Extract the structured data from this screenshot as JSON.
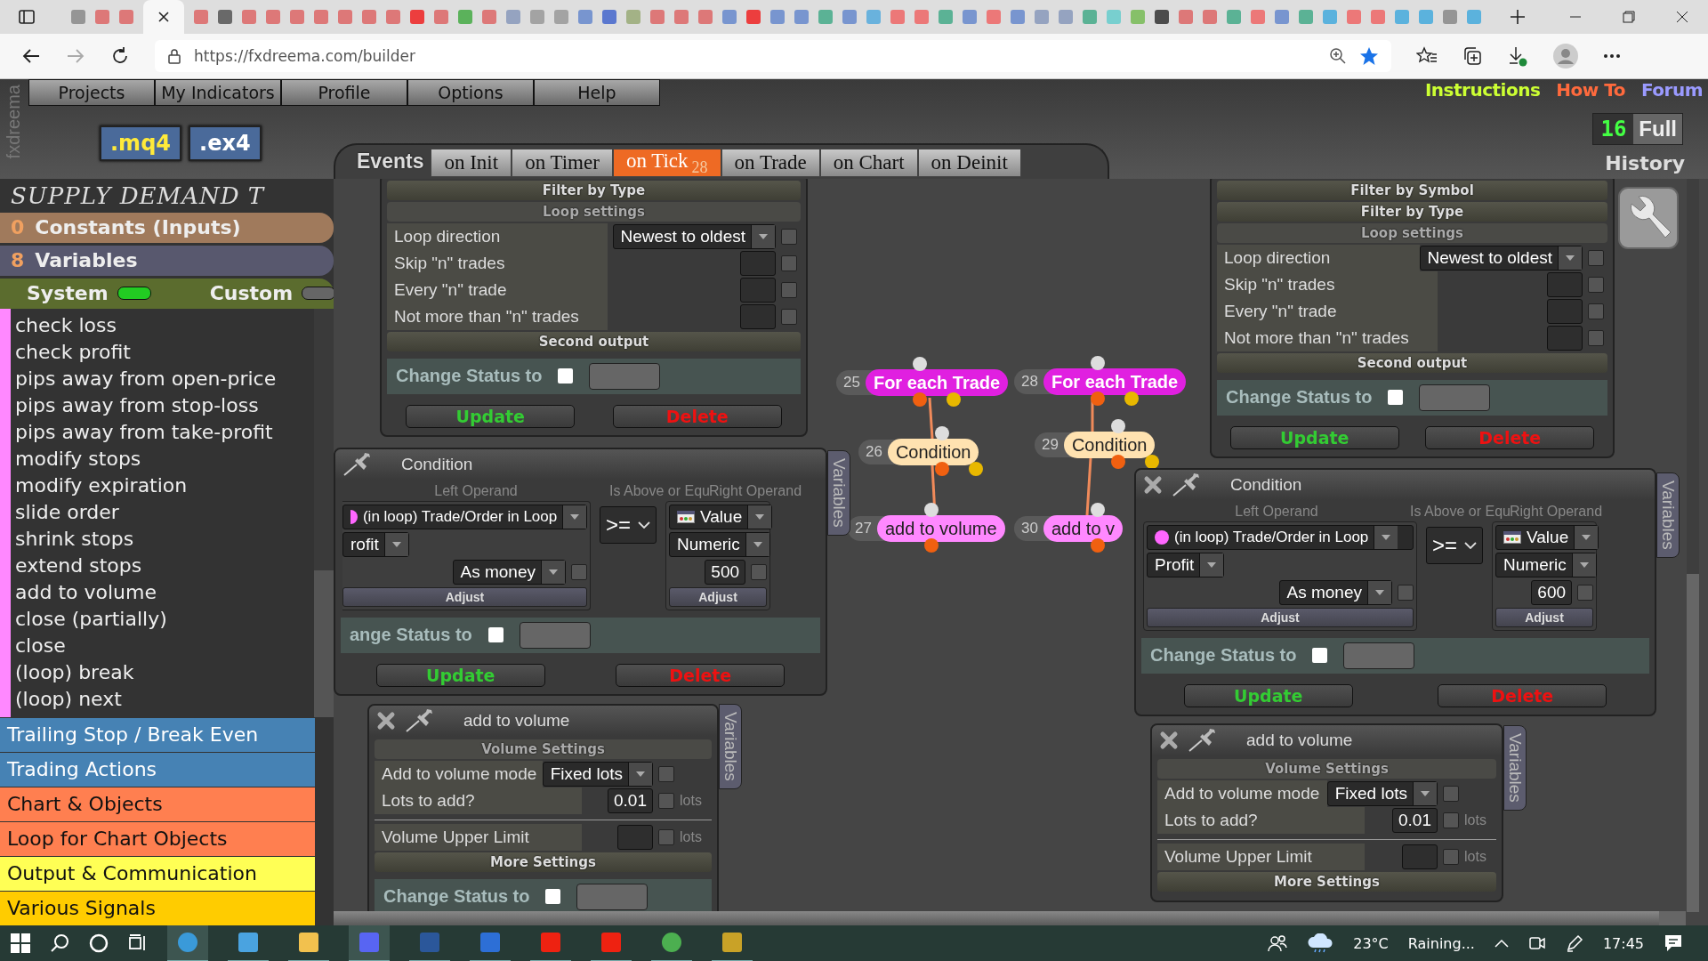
{
  "browser": {
    "url": "https://fxdreema.com/builder"
  },
  "header": {
    "brand": "fxdreema",
    "menu": [
      "Projects",
      "My Indicators",
      "Profile",
      "Options",
      "Help"
    ],
    "links": [
      {
        "label": "Instructions",
        "color": "#ccff33"
      },
      {
        "label": "How To",
        "color": "#ff6a3d"
      },
      {
        "label": "Forum",
        "color": "#9a9aff"
      }
    ],
    "exports": [
      ".mq4",
      ".ex4"
    ],
    "history": {
      "count": "16",
      "mode": "Full",
      "label": "History"
    }
  },
  "events": {
    "label": "Events",
    "tabs": [
      {
        "label": "on Init",
        "selected": false
      },
      {
        "label": "on Timer",
        "selected": false
      },
      {
        "label": "on Tick",
        "badge": "28",
        "selected": true
      },
      {
        "label": "on Trade",
        "selected": false
      },
      {
        "label": "on Chart",
        "selected": false
      },
      {
        "label": "on Deinit",
        "selected": false
      }
    ]
  },
  "sidebar": {
    "project": "SUPPLY DEMAND T",
    "constants": {
      "count": "0",
      "label": "Constants (Inputs)"
    },
    "variables": {
      "count": "8",
      "label": "Variables"
    },
    "toggles": [
      {
        "label": "System",
        "on": true
      },
      {
        "label": "Custom",
        "on": false
      }
    ],
    "blocks": [
      "check loss",
      "check profit",
      "pips away from open-price",
      "pips away from stop-loss",
      "pips away from take-profit",
      "modify stops",
      "modify expiration",
      "slide order",
      "shrink stops",
      "extend stops",
      "add to volume",
      "close (partially)",
      "close",
      "(loop) break",
      "(loop) next"
    ],
    "categories": [
      {
        "label": "Trailing Stop / Break Even",
        "color": "#4682b4"
      },
      {
        "label": "Trading Actions",
        "color": "#4682b4"
      },
      {
        "label": "Chart & Objects",
        "color": "#ff7f50"
      },
      {
        "label": "Loop for Chart Objects",
        "color": "#ff7f50"
      },
      {
        "label": "Output & Communication",
        "color": "#ffff55"
      },
      {
        "label": "Various Signals",
        "color": "#ffcc00"
      }
    ]
  },
  "canvas": {
    "panels": [
      {
        "kind": "loop",
        "filters": [
          "Filter by Type"
        ],
        "header": "Loop settings",
        "rows": [
          {
            "label": "Loop direction",
            "value": "Newest to oldest",
            "checked": false
          },
          {
            "label": "Skip \"n\" trades",
            "checked": false
          },
          {
            "label": "Every \"n\" trade",
            "checked": false
          },
          {
            "label": "Not more than \"n\" trades",
            "checked": false
          }
        ],
        "second": "Second output",
        "status": {
          "label": "Change Status to",
          "checked": false
        },
        "buttons": [
          "Update",
          "Delete"
        ]
      },
      {
        "kind": "loop",
        "filters": [
          "Filter by Symbol",
          "Filter by Type"
        ],
        "header": "Loop settings",
        "rows": [
          {
            "label": "Loop direction",
            "value": "Newest to oldest",
            "checked": false
          },
          {
            "label": "Skip \"n\" trades",
            "checked": false
          },
          {
            "label": "Every \"n\" trade",
            "checked": false
          },
          {
            "label": "Not more than \"n\" trades",
            "checked": false
          }
        ],
        "second": "Second output",
        "status": {
          "label": "Change Status to",
          "checked": false
        },
        "buttons": [
          "Update",
          "Delete"
        ]
      },
      {
        "kind": "condition",
        "closable": false,
        "title": "Condition",
        "labels": [
          "Left Operand",
          "Is Above or Equ",
          "Right Operand"
        ],
        "left": {
          "source": "(in loop) Trade/Order in Loop",
          "field": "rofit",
          "mode": "As money",
          "checked": false,
          "adjust": "Adjust"
        },
        "operator": ">=",
        "right": {
          "type": "Value",
          "format": "Numeric",
          "value": "500",
          "checked": false,
          "adjust": "Adjust"
        },
        "status": {
          "label": "ange Status to",
          "checked": false
        },
        "buttons": [
          "Update",
          "Delete"
        ],
        "tab": "Variables"
      },
      {
        "kind": "condition",
        "closable": true,
        "title": "Condition",
        "labels": [
          "Left Operand",
          "Is Above or Equ",
          "Right Operand"
        ],
        "left": {
          "source": "(in loop) Trade/Order in Loop",
          "field": "Profit",
          "mode": "As money",
          "checked": false,
          "adjust": "Adjust"
        },
        "operator": ">=",
        "right": {
          "type": "Value",
          "format": "Numeric",
          "value": "600",
          "checked": false,
          "adjust": "Adjust"
        },
        "status": {
          "label": "Change Status to",
          "checked": false
        },
        "buttons": [
          "Update",
          "Delete"
        ],
        "tab": "Variables"
      },
      {
        "kind": "volume",
        "closable": true,
        "title": "add to volume",
        "header": "Volume Settings",
        "rows": [
          {
            "label": "Add to volume mode",
            "value": "Fixed lots",
            "select": true,
            "checked": false
          },
          {
            "label": "Lots to add?",
            "value": "0.01",
            "unit": "lots",
            "checked": false
          },
          {
            "label": "Volume Upper Limit",
            "unit": "lots",
            "checked": false
          }
        ],
        "more": "More Settings",
        "status": {
          "label": "Change Status to",
          "checked": false
        },
        "tab": "Variables"
      },
      {
        "kind": "volume",
        "closable": true,
        "title": "add to volume",
        "header": "Volume Settings",
        "rows": [
          {
            "label": "Add to volume mode",
            "value": "Fixed lots",
            "select": true,
            "checked": false
          },
          {
            "label": "Lots to add?",
            "value": "0.01",
            "unit": "lots",
            "checked": false
          },
          {
            "label": "Volume Upper Limit",
            "unit": "lots",
            "checked": false
          }
        ],
        "more": "More Settings",
        "tab": "Variables"
      }
    ],
    "nodes": [
      {
        "number": "25",
        "label": "For each Trade",
        "color": "#e020e0"
      },
      {
        "number": "26",
        "label": "Condition",
        "color": "#ffe2b0"
      },
      {
        "number": "27",
        "label": "add to volume",
        "color": "#ff88ff"
      },
      {
        "number": "28",
        "label": "For each Trade",
        "color": "#e020e0"
      },
      {
        "number": "29",
        "label": "Condition",
        "color": "#ffe2b0"
      },
      {
        "number": "30",
        "label": "add to v",
        "color": "#ff88ff"
      }
    ]
  },
  "taskbar": {
    "temperature": "23°C",
    "weather": "Raining...",
    "time": "17:45"
  }
}
